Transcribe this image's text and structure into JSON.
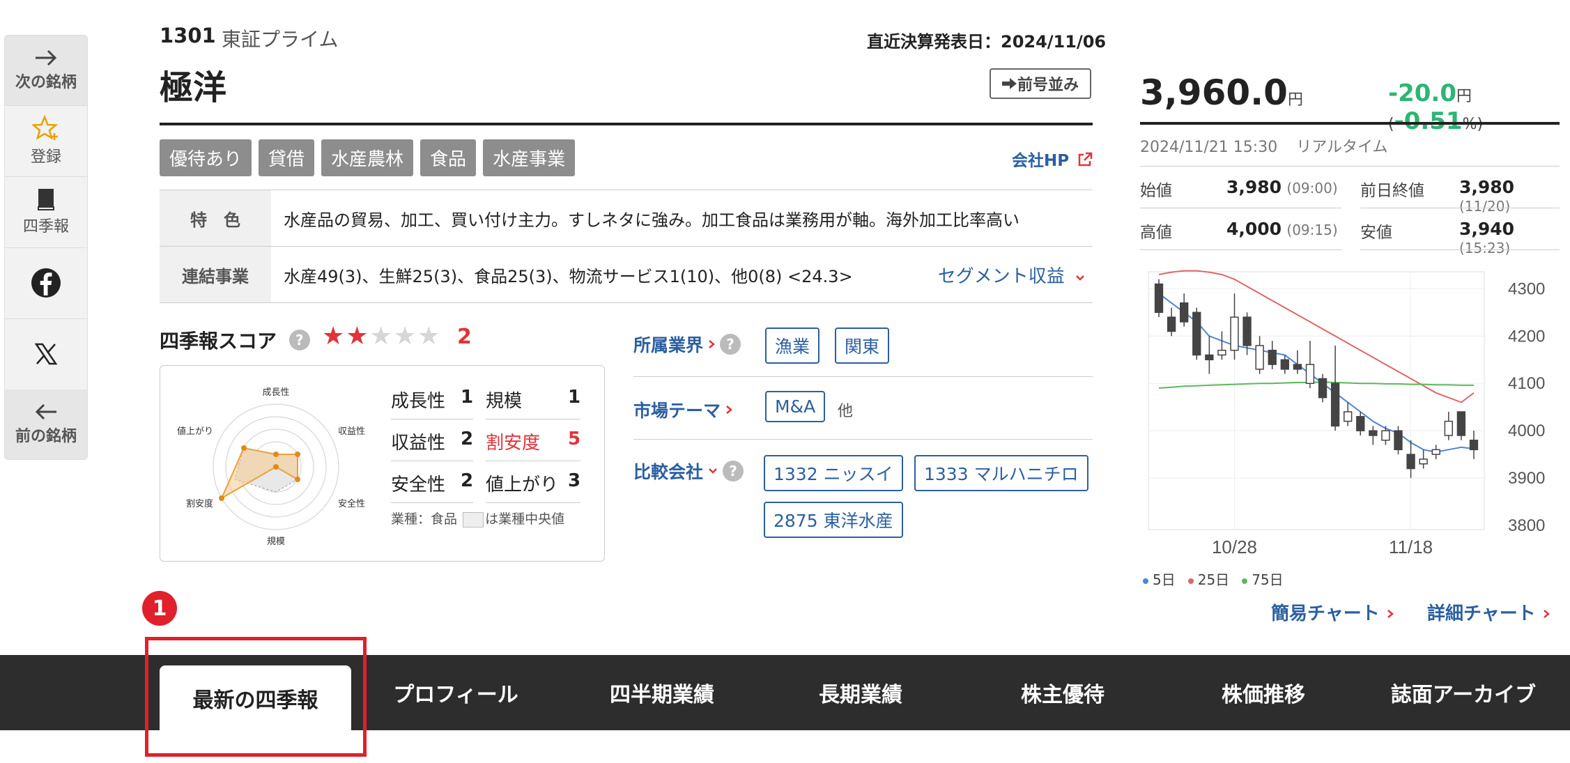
{
  "rail": {
    "next_label": "次の銘柄",
    "register_label": "登録",
    "shikiho_label": "四季報",
    "prev_label": "前の銘柄"
  },
  "header": {
    "code": "1301",
    "market": "東証プライム",
    "company_name": "極洋",
    "kessan_date": "直近決算発表日：2024/11/06",
    "prev_issue_button": "前号並み",
    "company_hp": "会社HP"
  },
  "tags": [
    "優待あり",
    "貸借",
    "水産農林",
    "食品",
    "水産事業"
  ],
  "info": {
    "feature_label": "特　色",
    "feature_text": "水産品の貿易、加工、買い付け主力。すしネタに強み。加工食品は業務用が軸。海外加工比率高い",
    "business_label": "連結事業",
    "business_text": "水産49(3)、生鮮25(3)、食品25(3)、物流サービス1(10)、他0(8) <24.3>",
    "segment_link": "セグメント収益"
  },
  "score": {
    "title": "四季報スコア",
    "help": "?",
    "stars_on": "★★",
    "stars_off": "★★★",
    "total": "2",
    "total_value": 2,
    "radar_labels": {
      "growth": "成長性",
      "profit": "収益性",
      "safety": "安全性",
      "scale": "規模",
      "cheap": "割安度",
      "rise": "値上がり"
    },
    "metrics": [
      {
        "label": "成長性",
        "value": "1"
      },
      {
        "label": "規模",
        "value": "1"
      },
      {
        "label": "収益性",
        "value": "2"
      },
      {
        "label": "割安度",
        "value": "5"
      },
      {
        "label": "安全性",
        "value": "2"
      },
      {
        "label": "値上がり",
        "value": "3"
      }
    ],
    "note_prefix": "業種：食品",
    "note_suffix": "は業種中央値"
  },
  "industry": {
    "label": "所属業界",
    "chips": [
      "漁業",
      "関東"
    ]
  },
  "theme": {
    "label": "市場テーマ",
    "chips": [
      "M&A"
    ],
    "more": "他"
  },
  "compare": {
    "label": "比較会社",
    "chips": [
      "1332 ニッスイ",
      "1333 マルハニチロ",
      "2875 東洋水産"
    ]
  },
  "price": {
    "value": "3,960.0",
    "unit": "円",
    "change": "-20.0",
    "change_unit": "円",
    "change_pct_open": "(",
    "change_pct": "-0.51",
    "change_pct_close": "%)",
    "timestamp": "2024/11/21 15:30",
    "realtime": "リアルタイム",
    "quotes": {
      "open_label": "始値",
      "open": "3,980",
      "open_time": "(09:00)",
      "prevclose_label": "前日終値",
      "prevclose": "3,980",
      "prevclose_time": "(11/20)",
      "high_label": "高値",
      "high": "4,000",
      "high_time": "(09:15)",
      "low_label": "安値",
      "low": "3,940",
      "low_time": "(15:23)"
    }
  },
  "chart_data": {
    "type": "candlestick",
    "yticks": [
      "4300",
      "4200",
      "4100",
      "4000",
      "3900",
      "3800"
    ],
    "ylim": [
      3800,
      4330
    ],
    "xticks": [
      "10/28",
      "11/18"
    ],
    "candles": [
      {
        "o": 4310,
        "c": 4250,
        "h": 4320,
        "l": 4240
      },
      {
        "o": 4240,
        "c": 4210,
        "h": 4260,
        "l": 4200
      },
      {
        "o": 4270,
        "c": 4230,
        "h": 4290,
        "l": 4220
      },
      {
        "o": 4250,
        "c": 4160,
        "h": 4260,
        "l": 4150
      },
      {
        "o": 4160,
        "c": 4150,
        "h": 4200,
        "l": 4120
      },
      {
        "o": 4160,
        "c": 4170,
        "h": 4210,
        "l": 4150
      },
      {
        "o": 4170,
        "c": 4240,
        "h": 4290,
        "l": 4150
      },
      {
        "o": 4240,
        "c": 4180,
        "h": 4250,
        "l": 4160
      },
      {
        "o": 4130,
        "c": 4180,
        "h": 4200,
        "l": 4120
      },
      {
        "o": 4170,
        "c": 4140,
        "h": 4190,
        "l": 4130
      },
      {
        "o": 4150,
        "c": 4130,
        "h": 4160,
        "l": 4120
      },
      {
        "o": 4140,
        "c": 4130,
        "h": 4170,
        "l": 4120
      },
      {
        "o": 4100,
        "c": 4140,
        "h": 4190,
        "l": 4090
      },
      {
        "o": 4110,
        "c": 4070,
        "h": 4120,
        "l": 4060
      },
      {
        "o": 4100,
        "c": 4010,
        "h": 4180,
        "l": 4000
      },
      {
        "o": 4020,
        "c": 4040,
        "h": 4060,
        "l": 4010
      },
      {
        "o": 4030,
        "c": 4000,
        "h": 4040,
        "l": 3990
      },
      {
        "o": 4000,
        "c": 3990,
        "h": 4010,
        "l": 3970
      },
      {
        "o": 3980,
        "c": 4000,
        "h": 4010,
        "l": 3970
      },
      {
        "o": 4000,
        "c": 3960,
        "h": 4010,
        "l": 3950
      },
      {
        "o": 3950,
        "c": 3920,
        "h": 3980,
        "l": 3900
      },
      {
        "o": 3930,
        "c": 3940,
        "h": 3960,
        "l": 3920
      },
      {
        "o": 3950,
        "c": 3960,
        "h": 3970,
        "l": 3940
      },
      {
        "o": 3990,
        "c": 4020,
        "h": 4040,
        "l": 3980
      },
      {
        "o": 4040,
        "c": 3990,
        "h": 4040,
        "l": 3980
      },
      {
        "o": 3980,
        "c": 3960,
        "h": 4000,
        "l": 3940
      }
    ],
    "ma5": [
      4290,
      4270,
      4250,
      4230,
      4200,
      4190,
      4180,
      4175,
      4170,
      4165,
      4160,
      4140,
      4120,
      4100,
      4080,
      4060,
      4040,
      4020,
      4005,
      3995,
      3975,
      3960,
      3955,
      3960,
      3965,
      3962
    ],
    "ma25": [
      4330,
      4335,
      4338,
      4338,
      4335,
      4330,
      4320,
      4305,
      4290,
      4275,
      4260,
      4245,
      4230,
      4215,
      4200,
      4185,
      4170,
      4155,
      4140,
      4125,
      4110,
      4095,
      4080,
      4070,
      4060,
      4080
    ],
    "ma75": [
      4090,
      4092,
      4094,
      4095,
      4096,
      4097,
      4098,
      4099,
      4100,
      4100,
      4101,
      4102,
      4102,
      4103,
      4102,
      4101,
      4100,
      4100,
      4099,
      4099,
      4098,
      4098,
      4097,
      4097,
      4096,
      4096
    ],
    "legend": [
      "5日",
      "25日",
      "75日"
    ],
    "colors": {
      "ma5": "#4e86cf",
      "ma25": "#e06666",
      "ma75": "#5cb85c",
      "down": "#444444",
      "up": "#ffffff"
    }
  },
  "chart_links": {
    "simple": "簡易チャート",
    "detail": "詳細チャート"
  },
  "nav": {
    "tabs": [
      "最新の四季報",
      "プロフィール",
      "四半期業績",
      "長期業績",
      "株主優待",
      "株価推移",
      "誌面アーカイブ"
    ],
    "active_index": 0
  },
  "annotation": {
    "badge": "1"
  }
}
